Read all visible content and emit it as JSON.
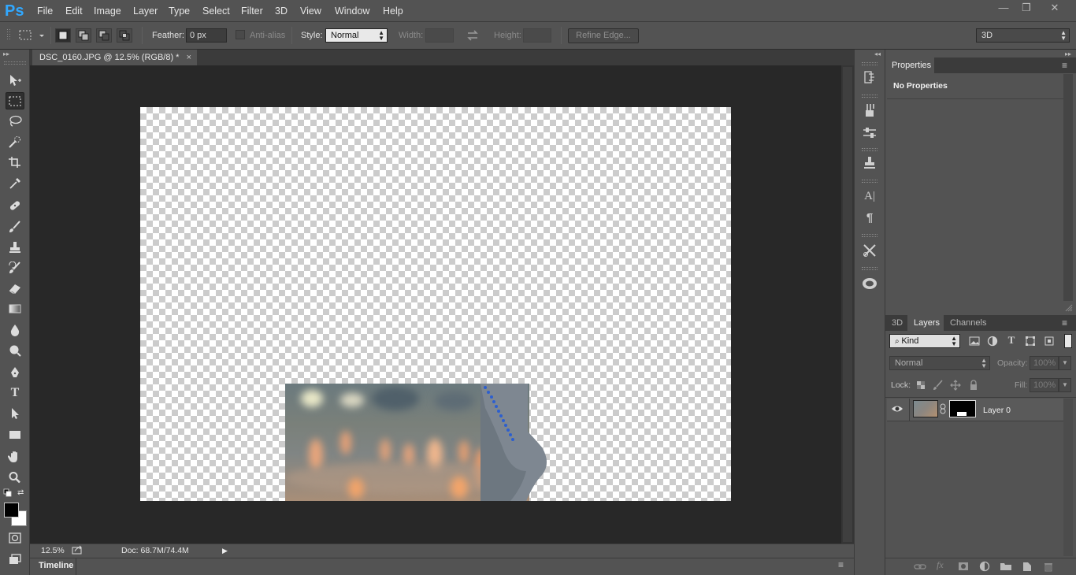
{
  "app": {
    "logo_text": "Ps"
  },
  "menu": {
    "items": [
      "File",
      "Edit",
      "Image",
      "Layer",
      "Type",
      "Select",
      "Filter",
      "3D",
      "View",
      "Window",
      "Help"
    ]
  },
  "window_controls": {
    "minimize": "—",
    "restore": "❐",
    "close": "✕"
  },
  "options_bar": {
    "feather_label": "Feather:",
    "feather_value": "0 px",
    "antialias_label": "Anti-alias",
    "style_label": "Style:",
    "style_value": "Normal",
    "width_label": "Width:",
    "height_label": "Height:",
    "refine_edge_label": "Refine Edge...",
    "workspace_value": "3D"
  },
  "document": {
    "tab_title": "DSC_0160.JPG @ 12.5% (RGB/8) *",
    "tab_close": "×"
  },
  "status": {
    "zoom": "12.5%",
    "doc_size": "Doc: 68.7M/74.4M"
  },
  "timeline": {
    "label": "Timeline"
  },
  "properties_panel": {
    "tab": "Properties",
    "message": "No Properties"
  },
  "layers_panel": {
    "tabs": [
      "3D",
      "Layers",
      "Channels"
    ],
    "active_tab": "Layers",
    "filter_kind": "Kind",
    "blend_mode": "Normal",
    "opacity_label": "Opacity:",
    "opacity_value": "100%",
    "lock_label": "Lock:",
    "fill_label": "Fill:",
    "fill_value": "100%",
    "layers": [
      {
        "name": "Layer 0",
        "visible": true,
        "has_mask": true
      }
    ]
  },
  "colors": {
    "foreground": "#000000",
    "background": "#ffffff",
    "ps_blue": "#31a8ff"
  }
}
